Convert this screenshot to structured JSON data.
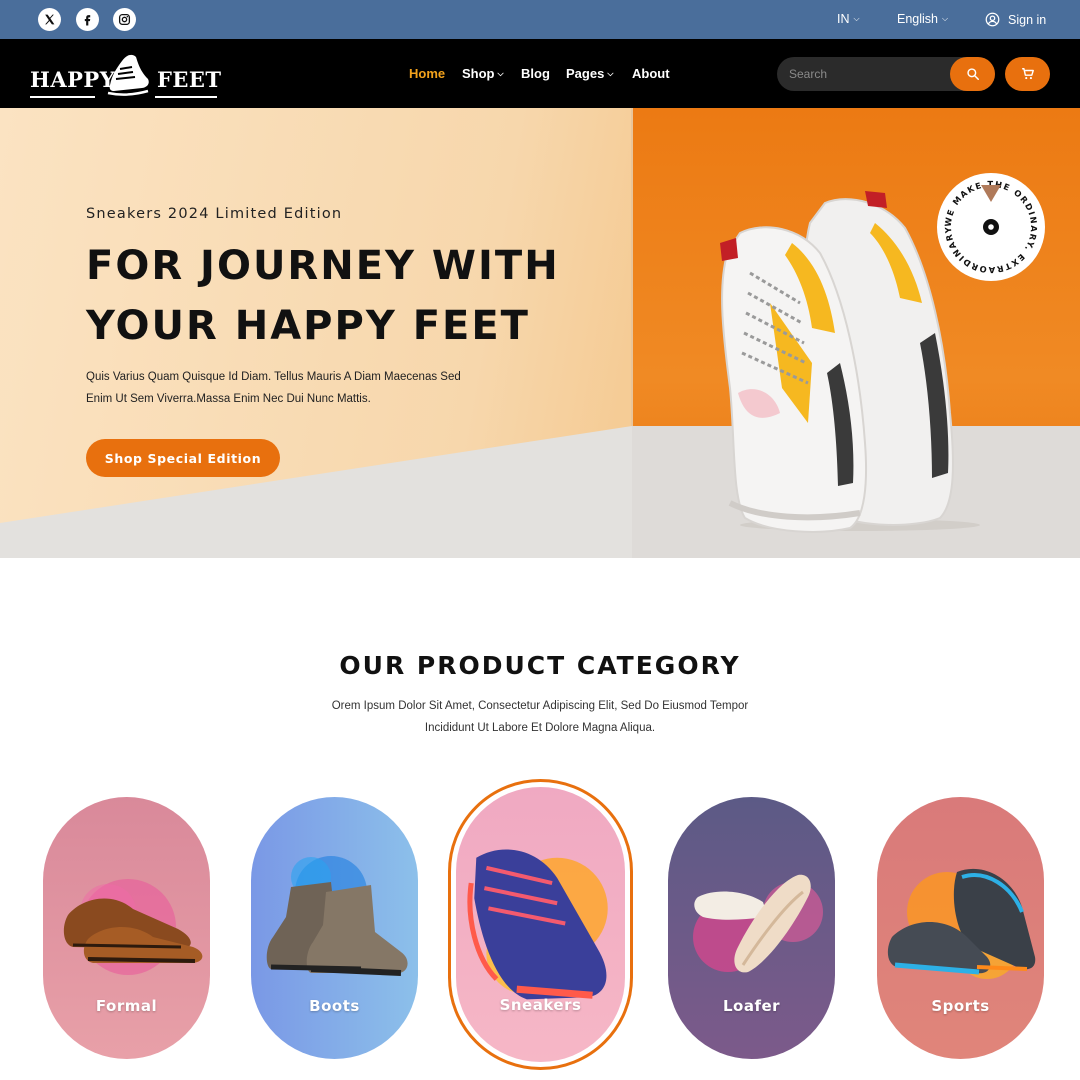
{
  "topbar": {
    "social": [
      {
        "icon": "x-twitter-icon"
      },
      {
        "icon": "facebook-icon"
      },
      {
        "icon": "instagram-icon"
      }
    ],
    "region": "IN",
    "language": "English",
    "signin": "Sign in"
  },
  "navbar": {
    "logo_left": "HAPPY",
    "logo_right": "FEET",
    "links": [
      {
        "label": "Home",
        "active": true,
        "has_dropdown": false
      },
      {
        "label": "Shop",
        "active": false,
        "has_dropdown": true
      },
      {
        "label": "Blog",
        "active": false,
        "has_dropdown": false
      },
      {
        "label": "Pages",
        "active": false,
        "has_dropdown": true
      },
      {
        "label": "About",
        "active": false,
        "has_dropdown": false
      }
    ],
    "search_placeholder": "Search"
  },
  "hero": {
    "kicker": "Sneakers 2024 Limited Edition",
    "title_line1": "FOR JOURNEY WITH",
    "title_line2": "YOUR HAPPY FEET",
    "desc_line1": "Quis Varius Quam Quisque Id Diam. Tellus Mauris A Diam Maecenas Sed",
    "desc_line2": "Enim Ut Sem Viverra.Massa Enim Nec Dui Nunc Mattis.",
    "cta": "Shop Special Edition",
    "badge_text": "WE MAKE THE ORDINARY. EXTRAORDINARY."
  },
  "category": {
    "title": "OUR PRODUCT CATEGORY",
    "desc_line1": "Orem Ipsum Dolor Sit Amet, Consectetur Adipiscing Elit, Sed Do Eiusmod Tempor",
    "desc_line2": "Incididunt Ut Labore Et Dolore Magna Aliqua.",
    "cards": [
      {
        "label": "Formal",
        "featured": false
      },
      {
        "label": "Boots",
        "featured": false
      },
      {
        "label": "Sneakers",
        "featured": true
      },
      {
        "label": "Loafer",
        "featured": false
      },
      {
        "label": "Sports",
        "featured": false
      }
    ]
  },
  "colors": {
    "topbar": "#4a6e9b",
    "navbar": "#000000",
    "accent": "#e8700e",
    "active_link": "#f3a21c"
  }
}
